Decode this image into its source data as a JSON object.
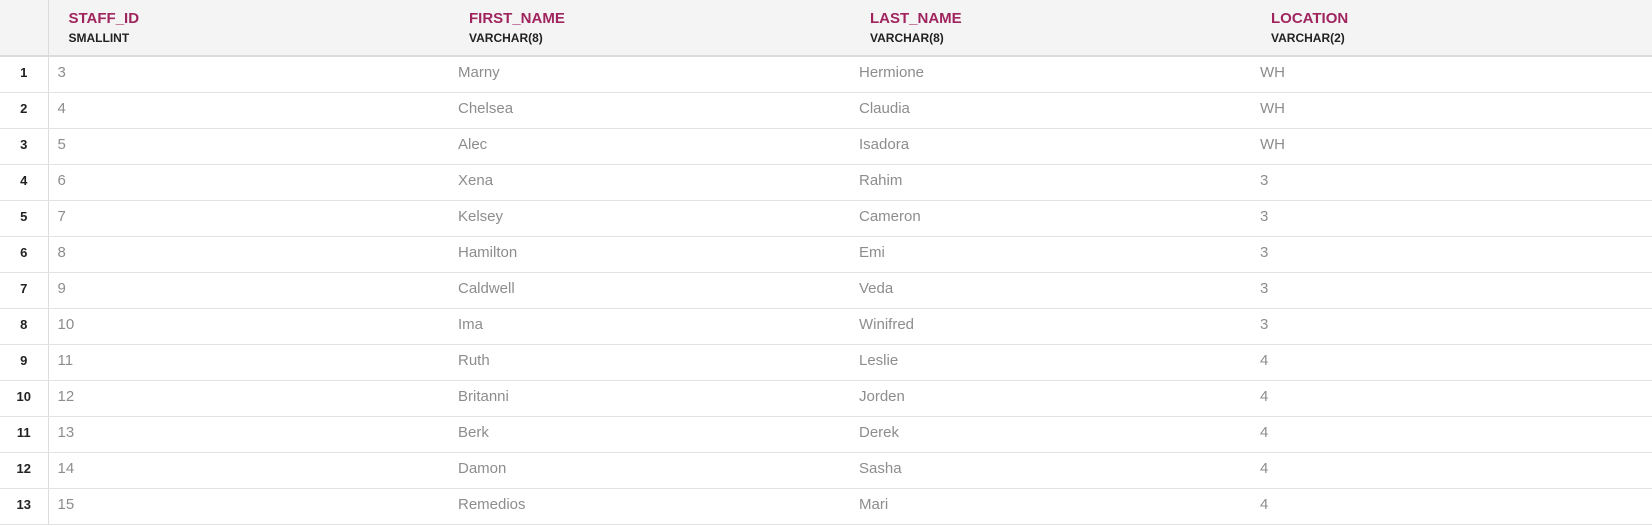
{
  "columns": [
    {
      "name": "STAFF_ID",
      "type": "SMALLINT"
    },
    {
      "name": "FIRST_NAME",
      "type": "VARCHAR(8)"
    },
    {
      "name": "LAST_NAME",
      "type": "VARCHAR(8)"
    },
    {
      "name": "LOCATION",
      "type": "VARCHAR(2)"
    }
  ],
  "rows": [
    {
      "n": "1",
      "cells": [
        "3",
        "Marny",
        "Hermione",
        "WH"
      ]
    },
    {
      "n": "2",
      "cells": [
        "4",
        "Chelsea",
        "Claudia",
        "WH"
      ]
    },
    {
      "n": "3",
      "cells": [
        "5",
        "Alec",
        "Isadora",
        "WH"
      ]
    },
    {
      "n": "4",
      "cells": [
        "6",
        "Xena",
        "Rahim",
        "3"
      ]
    },
    {
      "n": "5",
      "cells": [
        "7",
        "Kelsey",
        "Cameron",
        "3"
      ]
    },
    {
      "n": "6",
      "cells": [
        "8",
        "Hamilton",
        "Emi",
        "3"
      ]
    },
    {
      "n": "7",
      "cells": [
        "9",
        "Caldwell",
        "Veda",
        "3"
      ]
    },
    {
      "n": "8",
      "cells": [
        "10",
        "Ima",
        "Winifred",
        "3"
      ]
    },
    {
      "n": "9",
      "cells": [
        "11",
        "Ruth",
        "Leslie",
        "4"
      ]
    },
    {
      "n": "10",
      "cells": [
        "12",
        "Britanni",
        "Jorden",
        "4"
      ]
    },
    {
      "n": "11",
      "cells": [
        "13",
        "Berk",
        "Derek",
        "4"
      ]
    },
    {
      "n": "12",
      "cells": [
        "14",
        "Damon",
        "Sasha",
        "4"
      ]
    },
    {
      "n": "13",
      "cells": [
        "15",
        "Remedios",
        "Mari",
        "4"
      ]
    }
  ],
  "colors": {
    "column_name": "#a0245e",
    "header_bg": "#f4f4f4",
    "cell_text": "#8d8d8d"
  }
}
